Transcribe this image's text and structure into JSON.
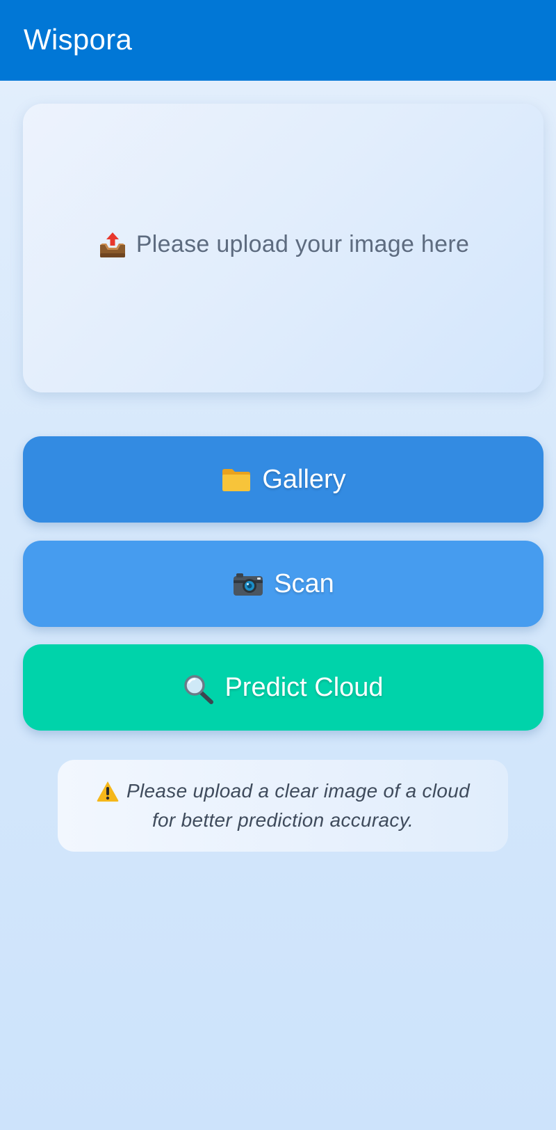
{
  "app_bar": {
    "title": "Wispora"
  },
  "upload_area": {
    "icon": "outbox-tray-icon",
    "text": "Please upload your image here"
  },
  "buttons": {
    "gallery": {
      "icon": "folder-icon",
      "label": "Gallery",
      "color": "#338be2"
    },
    "scan": {
      "icon": "camera-icon",
      "label": "Scan",
      "color": "#469cef"
    },
    "predict": {
      "icon": "magnifier-icon",
      "label": "Predict Cloud",
      "color": "#00d3aa"
    }
  },
  "notice": {
    "icon": "warning-icon",
    "line1": "Please upload a clear image of a cloud",
    "line2": "for better prediction accuracy."
  },
  "colors": {
    "app_bar": "#0177d6",
    "background": "#d6e8fb"
  }
}
